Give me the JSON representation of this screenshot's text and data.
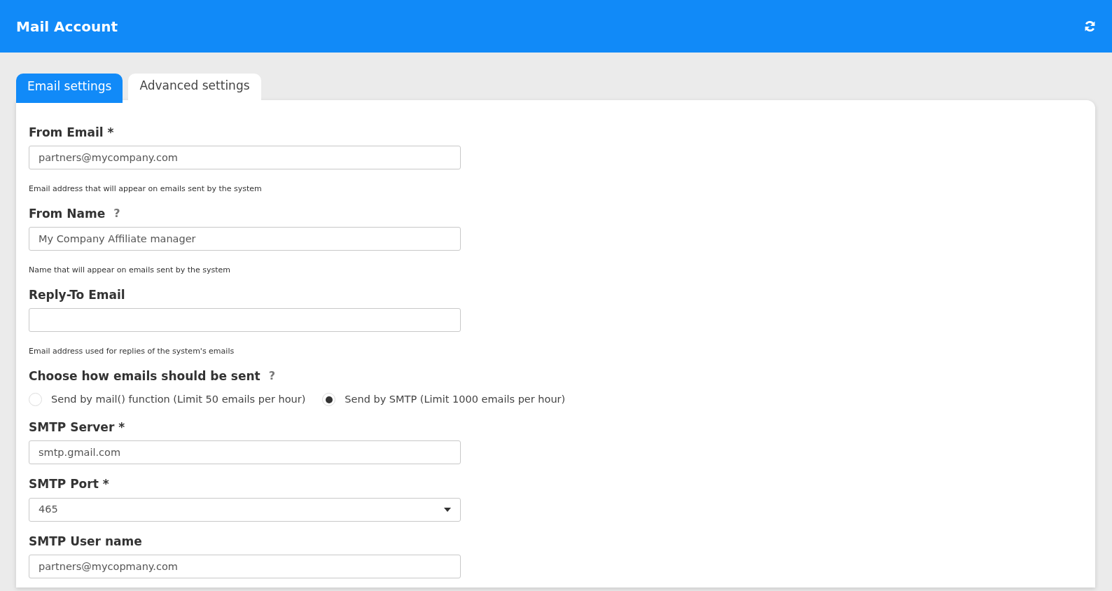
{
  "header": {
    "title": "Mail Account"
  },
  "tabs": [
    {
      "label": "Email settings",
      "selected": true
    },
    {
      "label": "Advanced settings",
      "selected": false
    }
  ],
  "fields": [
    {
      "kind": "text",
      "label": "From Email *",
      "value": "partners@mycompany.com",
      "help": "Email address that will appear on emails sent by the system"
    },
    {
      "kind": "text",
      "label": "From Name",
      "help_icon": "?",
      "value": "My Company Affiliate manager",
      "help": "Name that will appear on emails sent by the system"
    },
    {
      "kind": "text",
      "label": "Reply-To Email",
      "help": "Email address used for replies of the system's emails"
    },
    {
      "kind": "radio",
      "label": "Choose how emails should be sent",
      "help_icon": "?",
      "options": [
        {
          "label": "Send by mail() function (Limit 50 emails per hour)",
          "selected": false
        },
        {
          "label": "Send by SMTP (Limit 1000 emails per hour)",
          "selected": true
        }
      ]
    },
    {
      "kind": "text",
      "label": "SMTP Server *",
      "value": "smtp.gmail.com"
    },
    {
      "kind": "select",
      "label": "SMTP Port *",
      "value": "465"
    },
    {
      "kind": "text",
      "label": "SMTP User name",
      "value": "partners@mycopmany.com"
    }
  ]
}
